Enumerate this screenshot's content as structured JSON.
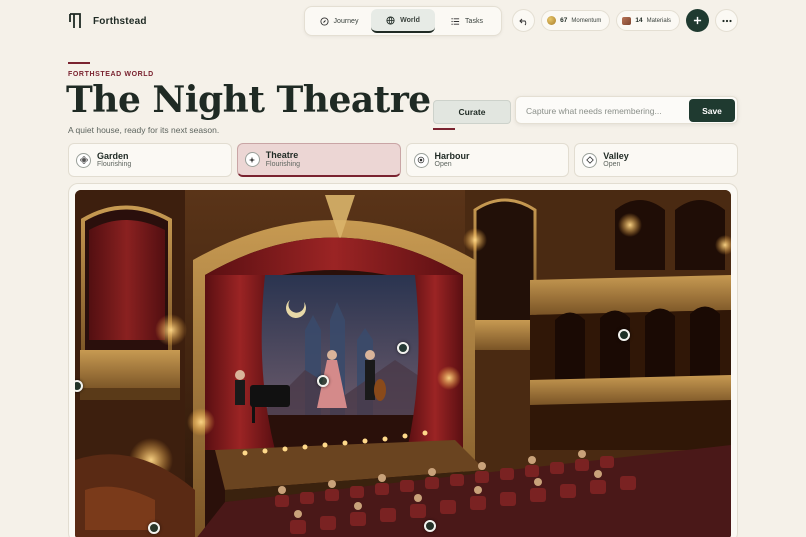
{
  "brand": {
    "name": "Forthstead"
  },
  "nav": {
    "items": [
      {
        "label": "Journey",
        "icon": "compass-icon",
        "active": false
      },
      {
        "label": "World",
        "icon": "globe-icon",
        "active": true
      },
      {
        "label": "Tasks",
        "icon": "list-icon",
        "active": false
      }
    ]
  },
  "stats": {
    "momentum": {
      "value": "67",
      "label": "Momentum"
    },
    "materials": {
      "value": "14",
      "label": "Materials"
    }
  },
  "page": {
    "eyebrow": "FORTHSTEAD WORLD",
    "title": "The Night Theatre",
    "subtitle": "A quiet house, ready for its next season."
  },
  "curate": {
    "label": "Curate"
  },
  "capture": {
    "placeholder": "Capture what needs remembering...",
    "value": "",
    "save_label": "Save"
  },
  "locations": [
    {
      "name": "Garden",
      "status": "Flourishing",
      "icon": "flower-icon",
      "active": false
    },
    {
      "name": "Theatre",
      "status": "Flourishing",
      "icon": "sparkle-icon",
      "active": true
    },
    {
      "name": "Harbour",
      "status": "Open",
      "icon": "target-icon",
      "active": false
    },
    {
      "name": "Valley",
      "status": "Open",
      "icon": "diamond-icon",
      "active": false
    }
  ],
  "colors": {
    "accent": "#7a2330",
    "primary": "#1f3a30",
    "background": "#f5f1e9"
  }
}
